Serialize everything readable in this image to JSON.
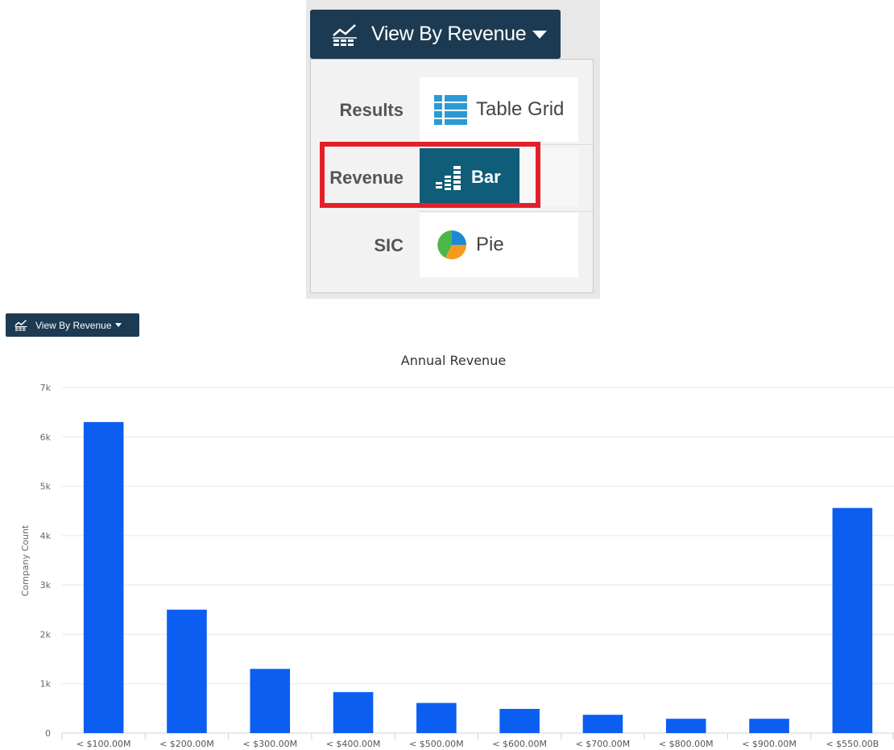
{
  "dropdown": {
    "button_label": "View By Revenue",
    "rows": [
      {
        "label": "Results",
        "item": "Table Grid",
        "icon": "table-grid-icon"
      },
      {
        "label": "Revenue",
        "item": "Bar",
        "icon": "bar-chart-icon",
        "selected": true
      },
      {
        "label": "SIC",
        "item": "Pie",
        "icon": "pie-chart-icon"
      }
    ],
    "highlight_color": "#e3202a",
    "selected_color": "#0f5d78"
  },
  "toolbar": {
    "button_label": "View By Revenue",
    "button_color": "#1c3b52"
  },
  "chart_data": {
    "type": "bar",
    "title": "Annual Revenue",
    "xlabel": "",
    "ylabel": "Company Count",
    "categories": [
      "< $100.00M",
      "< $200.00M",
      "< $300.00M",
      "< $400.00M",
      "< $500.00M",
      "< $600.00M",
      "< $700.00M",
      "< $800.00M",
      "< $900.00M",
      "< $550.00B"
    ],
    "values": [
      6300,
      2500,
      1300,
      830,
      610,
      490,
      370,
      290,
      290,
      4560
    ],
    "ylim": [
      0,
      7000
    ],
    "yticks": [
      0,
      1000,
      2000,
      3000,
      4000,
      5000,
      6000,
      7000
    ],
    "ytick_labels": [
      "0",
      "1k",
      "2k",
      "3k",
      "4k",
      "5k",
      "6k",
      "7k"
    ],
    "bar_color": "#0b5ef0",
    "grid": true,
    "legend": "none"
  }
}
